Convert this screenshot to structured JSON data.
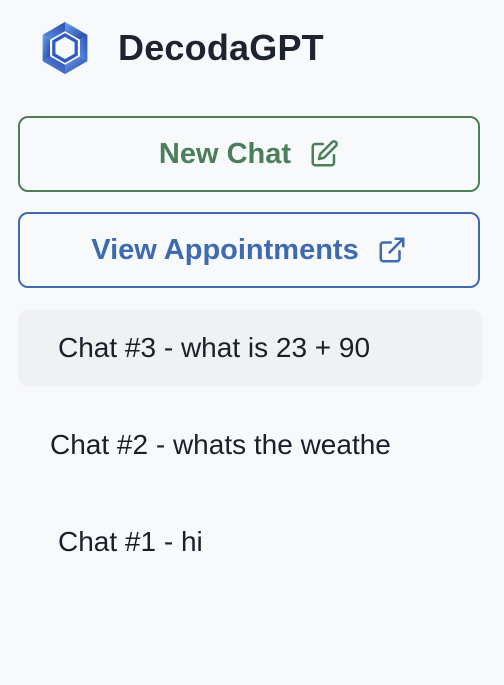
{
  "app": {
    "title": "DecodaGPT",
    "logo_icon": "hexagon-swirl-logo"
  },
  "actions": {
    "new_chat_label": "New Chat",
    "new_chat_icon": "edit-icon",
    "view_appointments_label": "View Appointments",
    "view_appointments_icon": "external-link-icon"
  },
  "chats": [
    {
      "label": "Chat #3 - what is 23 + 90",
      "active": true
    },
    {
      "label": "Chat #2 - whats the weathe",
      "active": false
    },
    {
      "label": "Chat #1 - hi",
      "active": false
    }
  ],
  "colors": {
    "background": "#f8f9fb",
    "new_chat_accent": "#4a7f59",
    "appointments_accent": "#3e6bb0",
    "active_chat_bg": "#f0f1f3",
    "logo_blue": "#3a66c4"
  }
}
